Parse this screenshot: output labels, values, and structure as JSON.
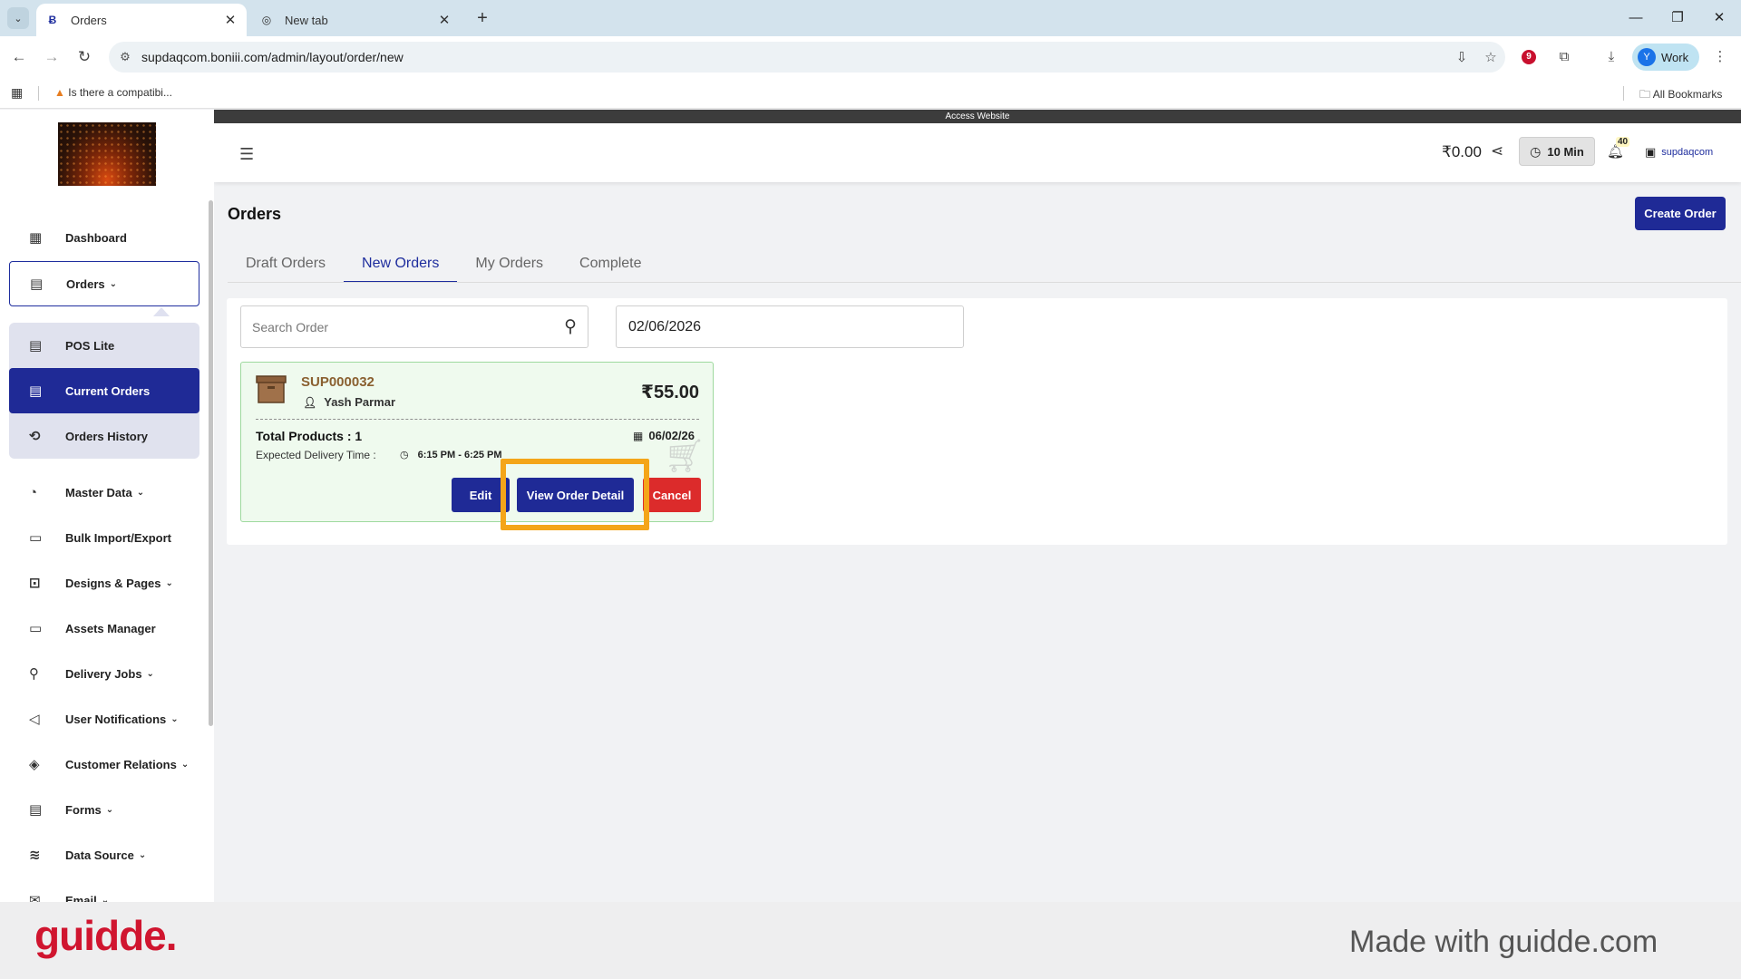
{
  "browser": {
    "tabs": [
      {
        "title": "Orders",
        "favicon": "boniii-logo-icon"
      },
      {
        "title": "New tab",
        "favicon": "chrome-icon"
      }
    ],
    "url": "supdaqcom.boniii.com/admin/layout/order/new",
    "profile_initial": "Y",
    "profile_label": "Work",
    "bookmark_1": "Is there a compatibi...",
    "all_bookmarks": "All Bookmarks",
    "extension_badge": "9"
  },
  "app": {
    "access_bar": "Access Website",
    "balance": "₹0.00",
    "timer": "10 Min",
    "notification_count": "40",
    "store_name": "supdaqcom"
  },
  "sidebar": {
    "items": [
      {
        "label": "Dashboard",
        "icon": "dashboard-icon"
      },
      {
        "label": "Orders",
        "icon": "orders-icon"
      },
      {
        "label": "Master Data",
        "icon": "master-data-icon"
      },
      {
        "label": "Bulk Import/Export",
        "icon": "folder-icon"
      },
      {
        "label": "Designs & Pages",
        "icon": "designs-icon"
      },
      {
        "label": "Assets Manager",
        "icon": "folder-icon"
      },
      {
        "label": "Delivery Jobs",
        "icon": "delivery-icon"
      },
      {
        "label": "User Notifications",
        "icon": "megaphone-icon"
      },
      {
        "label": "Customer Relations",
        "icon": "handshake-icon"
      },
      {
        "label": "Forms",
        "icon": "forms-icon"
      },
      {
        "label": "Data Source",
        "icon": "database-icon"
      },
      {
        "label": "Email",
        "icon": "email-icon"
      }
    ],
    "sub_items": [
      {
        "label": "POS Lite"
      },
      {
        "label": "Current Orders"
      },
      {
        "label": "Orders History"
      }
    ]
  },
  "page": {
    "title": "Orders",
    "create_button": "Create Order",
    "tabs": [
      {
        "label": "Draft Orders"
      },
      {
        "label": "New Orders"
      },
      {
        "label": "My Orders"
      },
      {
        "label": "Complete"
      }
    ],
    "search_placeholder": "Search Order",
    "date": "02/06/2026"
  },
  "order": {
    "id": "SUP000032",
    "customer": "Yash Parmar",
    "amount": "₹55.00",
    "total_products": "Total Products : 1",
    "date": "06/02/26",
    "delivery_label": "Expected Delivery Time :",
    "delivery_time": "6:15 PM - 6:25 PM",
    "edit_label": "Edit",
    "view_label": "View Order Detail",
    "cancel_label": "Cancel"
  },
  "footer": {
    "brand": "guidde.",
    "made_with": "Made with guidde.com"
  },
  "colors": {
    "primary": "#1f2a96",
    "danger": "#dc2b2b",
    "highlight": "#f4a519",
    "card_bg": "#effaee",
    "brand_red": "#d0152f"
  }
}
